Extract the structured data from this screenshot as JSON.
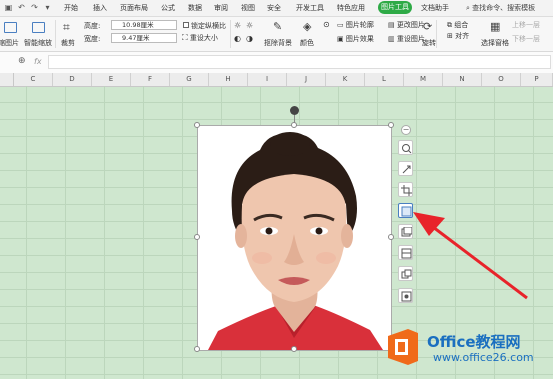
{
  "menubar": {
    "quick_icons": [
      "save-icon",
      "undo-icon",
      "redo-icon",
      "customize-icon"
    ],
    "tabs": [
      "开始",
      "插入",
      "页面布局",
      "公式",
      "数据",
      "审阅",
      "视图",
      "安全",
      "开发工具",
      "特色应用"
    ],
    "active_tab": "图片工具",
    "extra_tab": "文档助手",
    "search_text": "查找命令、搜索模板"
  },
  "ribbon": {
    "replace_pic": "缩图片",
    "smart_zoom": "智能缩放",
    "crop": "裁剪",
    "height_label": "高度:",
    "height_value": "10.98厘米",
    "width_label": "宽度:",
    "width_value": "9.47厘米",
    "lock_ratio": "锁定纵横比",
    "reset_size": "重设大小",
    "remove_bg": "抠除背景",
    "color": "颜色",
    "pic_outline": "图片轮廓",
    "pic_effect": "图片效果",
    "change_pic": "更改图片",
    "reset_pic": "重设图片",
    "rotate": "旋转",
    "align": "对齐",
    "select_pane": "选择窗格",
    "group": "组合",
    "bring_forward": "上移一层",
    "send_backward": "下移一层"
  },
  "formula_bar": {
    "zoom_icon": "magnifier-icon",
    "fx": "fx"
  },
  "columns": [
    "C",
    "D",
    "E",
    "F",
    "G",
    "H",
    "I",
    "J",
    "K",
    "L",
    "M",
    "N",
    "O",
    "P"
  ],
  "side_tools": [
    "minus-icon",
    "zoom-icon",
    "rotate-icon",
    "crop-icon",
    "image-layout-icon",
    "batch-icon",
    "gallery-icon",
    "wrap-icon",
    "more-icon"
  ],
  "colors": {
    "accent": "#2eaa46",
    "sheet_bg": "#cfe7cf",
    "arrow": "#e8232a",
    "logo_orange": "#f06a1a",
    "logo_blue": "#1a6fc0"
  },
  "logo": {
    "name": "Office教程网",
    "url": "www.office26.com"
  }
}
